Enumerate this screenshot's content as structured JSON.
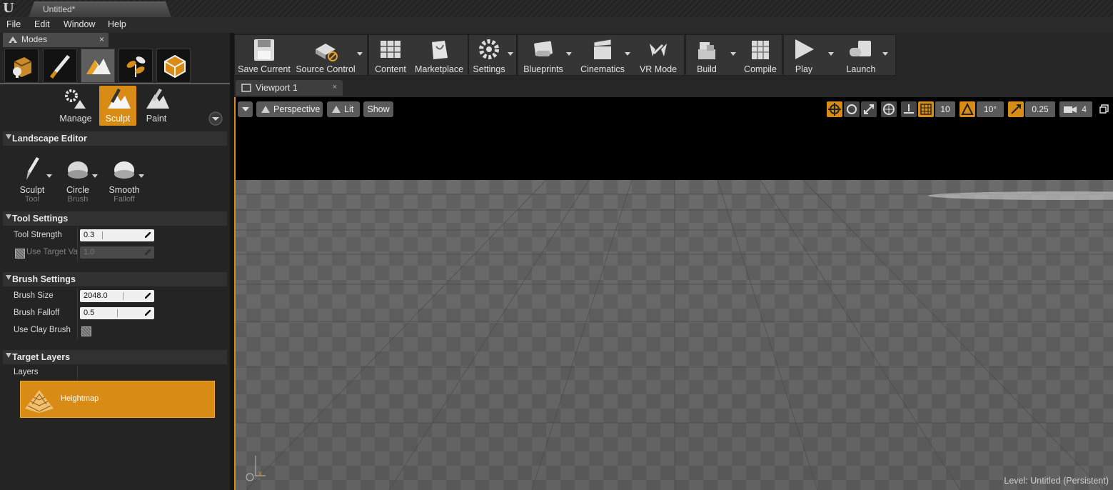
{
  "window": {
    "logo": "U",
    "doc_tab": "Untitled*"
  },
  "menu": [
    "File",
    "Edit",
    "Window",
    "Help"
  ],
  "modes_panel": {
    "tab_label": "Modes",
    "close": "×",
    "mode_icons": [
      "place-mode-icon",
      "paint-mode-icon",
      "landscape-mode-icon",
      "foliage-mode-icon",
      "geometry-mode-icon"
    ],
    "sub_modes": [
      "Manage",
      "Sculpt",
      "Paint"
    ],
    "active_sub_mode": "Sculpt",
    "landscape_editor": {
      "header": "Landscape Editor",
      "tools": [
        {
          "name": "Sculpt",
          "sub": "Tool"
        },
        {
          "name": "Circle",
          "sub": "Brush"
        },
        {
          "name": "Smooth",
          "sub": "Falloff"
        }
      ]
    },
    "tool_settings": {
      "header": "Tool Settings",
      "tool_strength_label": "Tool Strength",
      "tool_strength": "0.3",
      "use_target_label": "Use Target Va",
      "use_target_value": "1.0"
    },
    "brush_settings": {
      "header": "Brush Settings",
      "brush_size_label": "Brush Size",
      "brush_size": "2048.0",
      "brush_falloff_label": "Brush Falloff",
      "brush_falloff": "0.5",
      "use_clay_label": "Use Clay Brush"
    },
    "target_layers": {
      "header": "Target Layers",
      "layers_label": "Layers",
      "heightmap": "Heightmap"
    }
  },
  "toolbar": {
    "buttons": [
      "Save Current",
      "Source Control",
      "Content",
      "Marketplace",
      "Settings",
      "Blueprints",
      "Cinematics",
      "VR Mode",
      "Build",
      "Compile",
      "Play",
      "Launch"
    ]
  },
  "viewport": {
    "tab": "Viewport 1",
    "close": "×",
    "perspective": "Perspective",
    "lit": "Lit",
    "show": "Show",
    "grid_snap": "10",
    "rot_snap": "10°",
    "scale_snap": "0.25",
    "cam_speed": "4",
    "axis_label": "x",
    "status": "Level: Untitled (Persistent)"
  },
  "colors": {
    "accent": "#d98c15",
    "panel": "#242424",
    "toolbar": "#353535"
  }
}
